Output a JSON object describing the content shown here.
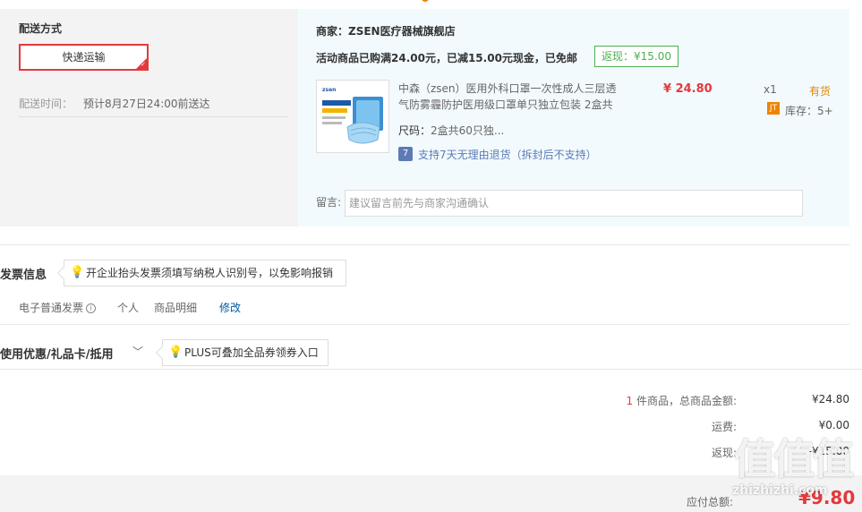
{
  "shipping": {
    "title": "配送方式",
    "method_label": "快递运输",
    "time_label": "配送时间：",
    "time_value": "预计8月27日24:00前送达"
  },
  "merchant": {
    "name": "商家：ZSEN医疗器械旗舰店",
    "promo": "活动商品已购满24.00元，已减15.00元现金，已免邮",
    "cashback": "返现：¥15.00"
  },
  "product": {
    "name": "中森（zsen）医用外科口罩一次性成人三层透气防雾霾防护医用级口罩单只独立包装 2盒共",
    "price": "¥ 24.80",
    "qty": "x1",
    "availability": "有货",
    "stock_badge": "JT",
    "stock_label": "库存：5+",
    "size_label": "尺码：",
    "size_value": "2盒共60只独...",
    "return_badge": "7",
    "return_text": "支持7天无理由退货（拆封后不支持）",
    "img_brand": "zsen"
  },
  "note": {
    "label": "留言:",
    "placeholder": "建议留言前先与商家沟通确认"
  },
  "invoice": {
    "title": "发票信息",
    "tip": "开企业抬头发票须填写纳税人识别号，以免影响报销",
    "type": "电子普通发票",
    "info_icon": "i",
    "holder": "个人",
    "content": "商品明细",
    "edit": "修改"
  },
  "coupons": {
    "title": "使用优惠/礼品卡/抵用",
    "chevron": "﹀",
    "tip": "PLUS可叠加全品券领券入口"
  },
  "summary": {
    "item_count": "1",
    "item_label": " 件商品，总商品金额:",
    "total": "¥24.80",
    "freight_label": "运费:",
    "freight": "¥0.00",
    "cashback_label": "返现:",
    "cashback": "-¥15.00",
    "payable_label": "应付总额:",
    "payable": "¥9.80"
  },
  "watermark": {
    "mark": "值值值",
    "site": "zhizhizhi.com"
  },
  "colors": {
    "accent_red": "#e4393c",
    "link_blue": "#005aa0",
    "cashback_green": "#4caf50",
    "stock_orange": "#f08200"
  }
}
